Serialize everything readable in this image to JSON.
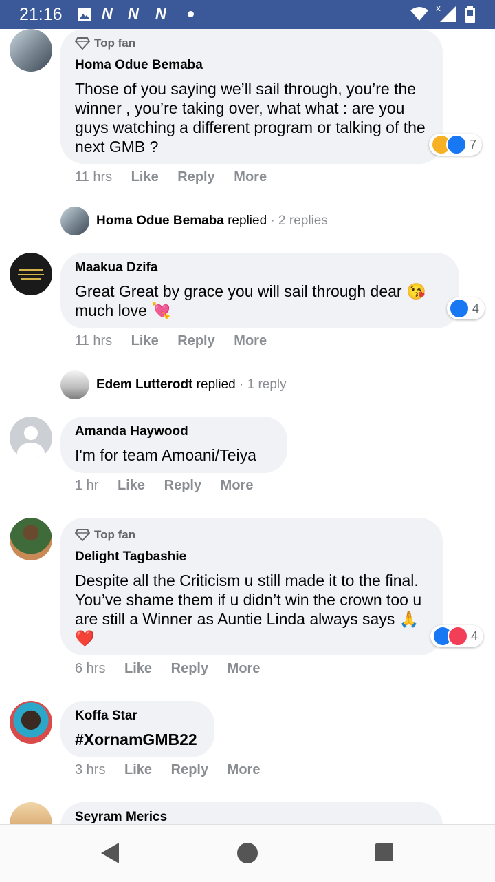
{
  "status_bar": {
    "time": "21:16",
    "icons": [
      "image-icon",
      "n-icon",
      "n-icon",
      "n-icon",
      "dot-icon",
      "wifi-icon",
      "signal-icon",
      "battery-icon"
    ]
  },
  "colors": {
    "status_bar": "#3b5998",
    "bubble": "#f0f2f5",
    "like_blue": "#1877f2",
    "love_red": "#f33e58",
    "haha_yellow": "#f7b125",
    "meta_grey": "#8a8d91"
  },
  "labels": {
    "like": "Like",
    "reply": "Reply",
    "more": "More",
    "top_fan": "Top fan"
  },
  "comments": [
    {
      "badge": "Top fan",
      "author": "Homa Odue Bemaba",
      "text": "Those of you saying we’ll sail through, you’re the winner , you’re taking over, what what : are you guys watching a different program or talking of the next GMB ?",
      "time": "11 hrs",
      "reactions": [
        "haha",
        "like"
      ],
      "reaction_count": "7",
      "replies": {
        "author": "Homa Odue Bemaba",
        "verb": "replied",
        "count": "· 2 replies"
      }
    },
    {
      "author": "Maakua Dzifa",
      "text": "Great Great by grace you will sail through dear 😘 much love 💘",
      "time": "11 hrs",
      "reactions": [
        "like"
      ],
      "reaction_count": "4",
      "replies": {
        "author": "Edem Lutterodt",
        "verb": "replied",
        "count": "· 1 reply"
      }
    },
    {
      "author": "Amanda Haywood",
      "text": "I'm for team Amoani/Teiya",
      "time": "1 hr"
    },
    {
      "badge": "Top fan",
      "author": "Delight Tagbashie",
      "text": "Despite all the Criticism u still made it to the final. You’ve shame them if u didn’t win the crown too u are still a Winner as Auntie Linda always says 🙏❤️",
      "time": "6 hrs",
      "reactions": [
        "like",
        "love"
      ],
      "reaction_count": "4"
    },
    {
      "author": "Koffa Star",
      "text": "#XornamGMB22",
      "time": "3 hrs"
    },
    {
      "author": "Seyram Merics"
    }
  ],
  "nav": [
    "back-button",
    "home-button",
    "recents-button"
  ]
}
